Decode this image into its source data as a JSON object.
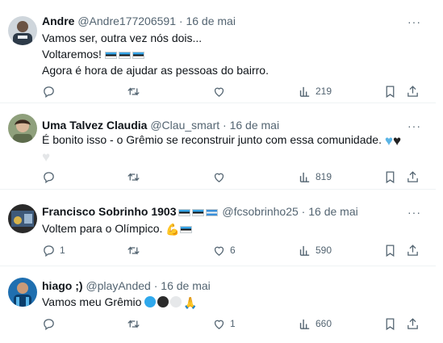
{
  "tweets": [
    {
      "name": "Andre",
      "handle": "@Andre177206591",
      "dot": "·",
      "date": "16 de mai",
      "lines": [
        "Vamos ser, outra vez nós dois...",
        "Voltaremos!",
        "Agora é hora de ajudar as pessoas do bairro."
      ],
      "reply_count": "",
      "retweet_count": "",
      "like_count": "",
      "views": "219"
    },
    {
      "name": "Uma Talvez Claudia",
      "handle": "@Clau_smart",
      "dot": "·",
      "date": "16 de mai",
      "lines": [
        "É bonito isso - o Grêmio se reconstruir junto com essa comunidade."
      ],
      "reply_count": "",
      "retweet_count": "",
      "like_count": "",
      "views": "819"
    },
    {
      "name": "Francisco Sobrinho 1903",
      "handle": "@fcsobrinho25",
      "dot": "·",
      "date": "16 de mai",
      "lines": [
        "Voltem para o Olímpico."
      ],
      "reply_count": "1",
      "retweet_count": "",
      "like_count": "6",
      "views": "590"
    },
    {
      "name": "hiago ;)",
      "handle": "@playAnded",
      "dot": "·",
      "date": "16 de mai",
      "lines": [
        "Vamos meu Grêmio"
      ],
      "reply_count": "",
      "retweet_count": "",
      "like_count": "1",
      "views": "660"
    }
  ],
  "more_label": "···",
  "icons": [
    "reply-icon",
    "retweet-icon",
    "like-icon",
    "views-icon",
    "bookmark-icon",
    "share-icon"
  ],
  "colors": {
    "text": "#0f1419",
    "muted": "#536471",
    "divider": "#eff3f4",
    "gremio_blue": "#36a5e8"
  }
}
